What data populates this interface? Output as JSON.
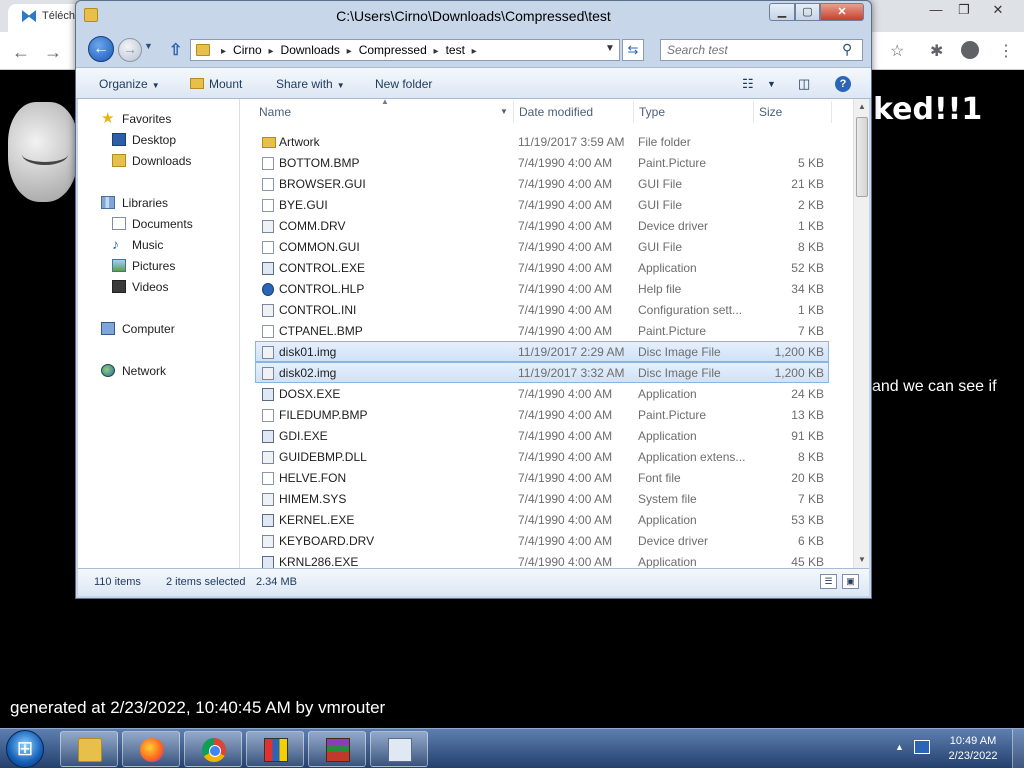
{
  "browser": {
    "tab_title": "Téléch",
    "win_min": "—",
    "win_max": "❐",
    "win_close": "✕",
    "back": "←",
    "forward": "→",
    "reload": "C",
    "bookmark": "☆",
    "extensions": "✱",
    "menu": "⋮"
  },
  "page": {
    "heading": "ked!!1",
    "text": "and we can see if",
    "generated": "generated at 2/23/2022, 10:40:45 AM by vmrouter"
  },
  "explorer": {
    "title": "C:\\Users\\Cirno\\Downloads\\Compressed\\test",
    "breadcrumbs": [
      "Cirno",
      "Downloads",
      "Compressed",
      "test"
    ],
    "search_placeholder": "Search test",
    "commands": {
      "organize": "Organize",
      "mount": "Mount",
      "share_with": "Share with",
      "new_folder": "New folder"
    },
    "nav": {
      "favorites": "Favorites",
      "desktop": "Desktop",
      "downloads": "Downloads",
      "libraries": "Libraries",
      "documents": "Documents",
      "music": "Music",
      "pictures": "Pictures",
      "videos": "Videos",
      "computer": "Computer",
      "network": "Network"
    },
    "columns": {
      "name": "Name",
      "date": "Date modified",
      "type": "Type",
      "size": "Size"
    },
    "files": [
      {
        "name": "Artwork",
        "date": "11/19/2017 3:59 AM",
        "type": "File folder",
        "size": "",
        "icon": "folder-icon"
      },
      {
        "name": "BOTTOM.BMP",
        "date": "7/4/1990 4:00 AM",
        "type": "Paint.Picture",
        "size": "5 KB",
        "icon": "file-icon"
      },
      {
        "name": "BROWSER.GUI",
        "date": "7/4/1990 4:00 AM",
        "type": "GUI File",
        "size": "21 KB",
        "icon": "file-icon"
      },
      {
        "name": "BYE.GUI",
        "date": "7/4/1990 4:00 AM",
        "type": "GUI File",
        "size": "2 KB",
        "icon": "file-icon"
      },
      {
        "name": "COMM.DRV",
        "date": "7/4/1990 4:00 AM",
        "type": "Device driver",
        "size": "1 KB",
        "icon": "driver-icon"
      },
      {
        "name": "COMMON.GUI",
        "date": "7/4/1990 4:00 AM",
        "type": "GUI File",
        "size": "8 KB",
        "icon": "file-icon"
      },
      {
        "name": "CONTROL.EXE",
        "date": "7/4/1990 4:00 AM",
        "type": "Application",
        "size": "52 KB",
        "icon": "app-icon"
      },
      {
        "name": "CONTROL.HLP",
        "date": "7/4/1990 4:00 AM",
        "type": "Help file",
        "size": "34 KB",
        "icon": "help-icon"
      },
      {
        "name": "CONTROL.INI",
        "date": "7/4/1990 4:00 AM",
        "type": "Configuration sett...",
        "size": "1 KB",
        "icon": "settings-icon"
      },
      {
        "name": "CTPANEL.BMP",
        "date": "7/4/1990 4:00 AM",
        "type": "Paint.Picture",
        "size": "7 KB",
        "icon": "file-icon"
      },
      {
        "name": "disk01.img",
        "date": "11/19/2017 2:29 AM",
        "type": "Disc Image File",
        "size": "1,200 KB",
        "icon": "disc-icon",
        "selected": true
      },
      {
        "name": "disk02.img",
        "date": "11/19/2017 3:32 AM",
        "type": "Disc Image File",
        "size": "1,200 KB",
        "icon": "disc-icon",
        "selected": true
      },
      {
        "name": "DOSX.EXE",
        "date": "7/4/1990 4:00 AM",
        "type": "Application",
        "size": "24 KB",
        "icon": "app-icon"
      },
      {
        "name": "FILEDUMP.BMP",
        "date": "7/4/1990 4:00 AM",
        "type": "Paint.Picture",
        "size": "13 KB",
        "icon": "file-icon"
      },
      {
        "name": "GDI.EXE",
        "date": "7/4/1990 4:00 AM",
        "type": "Application",
        "size": "91 KB",
        "icon": "app-icon"
      },
      {
        "name": "GUIDEBMP.DLL",
        "date": "7/4/1990 4:00 AM",
        "type": "Application extens...",
        "size": "8 KB",
        "icon": "settings-icon"
      },
      {
        "name": "HELVE.FON",
        "date": "7/4/1990 4:00 AM",
        "type": "Font file",
        "size": "20 KB",
        "icon": "font-icon"
      },
      {
        "name": "HIMEM.SYS",
        "date": "7/4/1990 4:00 AM",
        "type": "System file",
        "size": "7 KB",
        "icon": "settings-icon"
      },
      {
        "name": "KERNEL.EXE",
        "date": "7/4/1990 4:00 AM",
        "type": "Application",
        "size": "53 KB",
        "icon": "app-icon"
      },
      {
        "name": "KEYBOARD.DRV",
        "date": "7/4/1990 4:00 AM",
        "type": "Device driver",
        "size": "6 KB",
        "icon": "driver-icon"
      },
      {
        "name": "KRNL286.EXE",
        "date": "7/4/1990 4:00 AM",
        "type": "Application",
        "size": "45 KB",
        "icon": "app-icon"
      }
    ],
    "status": {
      "count": "110 items",
      "selected": "2 items selected",
      "selected_size": "2.34 MB"
    }
  },
  "taskbar": {
    "clock_time": "10:49 AM",
    "clock_date": "2/23/2022",
    "apps": [
      "explorer-icon",
      "firefox-icon",
      "chrome-icon",
      "qemu-icon",
      "winrar-icon",
      "app-icon"
    ]
  }
}
